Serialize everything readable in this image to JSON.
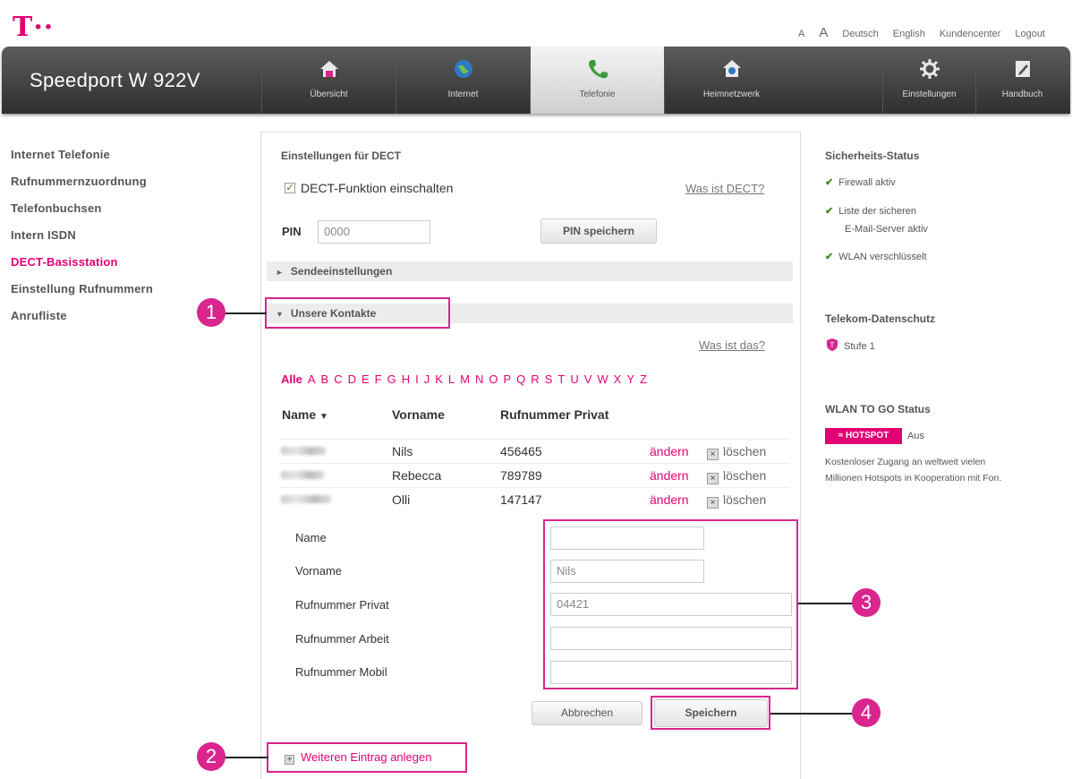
{
  "header": {
    "logo": "T··",
    "links": {
      "font_small": "A",
      "font_large": "A",
      "deutsch": "Deutsch",
      "english": "English",
      "kundencenter": "Kundencenter",
      "logout": "Logout"
    }
  },
  "nav": {
    "brand": "Speedport W 922V",
    "tabs": [
      {
        "label": "Übersicht",
        "icon": "house-icon"
      },
      {
        "label": "Internet",
        "icon": "globe-icon"
      },
      {
        "label": "Telefonie",
        "icon": "phone-icon"
      },
      {
        "label": "Heimnetzwerk",
        "icon": "home-network-icon"
      },
      {
        "label": "Einstellungen",
        "icon": "gear-icon"
      },
      {
        "label": "Handbuch",
        "icon": "manual-icon"
      }
    ],
    "active_tab": "Telefonie"
  },
  "sidebar": {
    "items": [
      {
        "label": "Internet Telefonie"
      },
      {
        "label": "Rufnummernzuordnung"
      },
      {
        "label": "Telefonbuchsen"
      },
      {
        "label": "Intern ISDN"
      },
      {
        "label": "DECT-Basisstation"
      },
      {
        "label": "Einstellung Rufnummern"
      },
      {
        "label": "Anrufliste"
      }
    ],
    "active_item": "DECT-Basisstation"
  },
  "main": {
    "title": "Einstellungen für DECT",
    "dect_checkbox_label": "DECT-Funktion einschalten",
    "dect_checked": true,
    "what_is_dect": "Was ist DECT?",
    "pin_label": "PIN",
    "pin_value": "0000",
    "pin_save": "PIN speichern",
    "section_send": "Sendeeinstellungen",
    "section_contacts": "Unsere Kontakte",
    "what_is_this": "Was ist das?",
    "letters": [
      "Alle",
      "A",
      "B",
      "C",
      "D",
      "E",
      "F",
      "G",
      "H",
      "I",
      "J",
      "K",
      "L",
      "M",
      "N",
      "O",
      "P",
      "Q",
      "R",
      "S",
      "T",
      "U",
      "V",
      "W",
      "X",
      "Y",
      "Z"
    ],
    "table": {
      "col_name": "Name",
      "col_firstname": "Vorname",
      "col_phone": "Rufnummer Privat",
      "rows": [
        {
          "firstname": "Nils",
          "phone": "456465",
          "edit": "ändern",
          "delete": "löschen"
        },
        {
          "firstname": "Rebecca",
          "phone": "789789",
          "edit": "ändern",
          "delete": "löschen"
        },
        {
          "firstname": "Olli",
          "phone": "147147",
          "edit": "ändern",
          "delete": "löschen"
        }
      ]
    },
    "form": {
      "name_label": "Name",
      "name_value": "",
      "firstname_label": "Vorname",
      "firstname_value": "Nils",
      "phone_private_label": "Rufnummer Privat",
      "phone_private_value": "04421",
      "phone_work_label": "Rufnummer Arbeit",
      "phone_work_value": "",
      "phone_mobile_label": "Rufnummer Mobil",
      "phone_mobile_value": ""
    },
    "cancel_button": "Abbrechen",
    "save_button": "Speichern",
    "add_entry": "Weiteren Eintrag anlegen"
  },
  "callouts": [
    "1",
    "2",
    "3",
    "4"
  ],
  "right": {
    "security_title": "Sicherheits-Status",
    "firewall": "Firewall aktiv",
    "mail_line1": "Liste der sicheren",
    "mail_line2": "E-Mail-Server aktiv",
    "wlan": "WLAN verschlüsselt",
    "privacy_title": "Telekom-Datenschutz",
    "privacy_level": "Stufe 1",
    "wlan_to_go_title": "WLAN TO GO Status",
    "hotspot_badge": "HOTSPOT",
    "hotspot_state": "Aus",
    "hotspot_text_1": "Kostenloser Zugang an weltweit vielen",
    "hotspot_text_2": "Millionen Hotspots in Kooperation mit Fon."
  },
  "colors": {
    "brand": "#e20074",
    "callout": "#d9258e"
  }
}
